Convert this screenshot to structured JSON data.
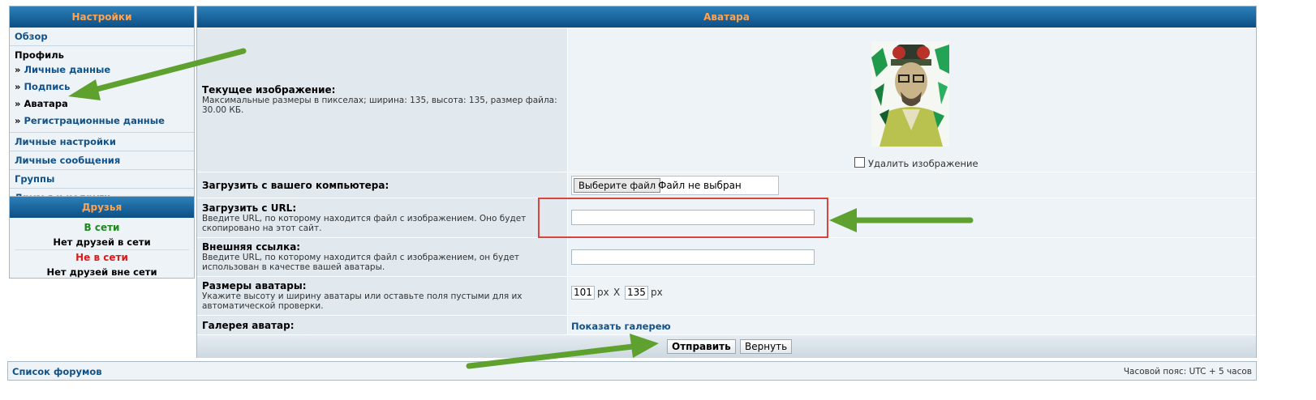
{
  "sidebar": {
    "title": "Настройки",
    "overview": "Обзор",
    "profile_title": "Профиль",
    "profile_items": [
      {
        "label": "Личные данные"
      },
      {
        "label": "Подпись"
      },
      {
        "label": "Аватара"
      },
      {
        "label": "Регистрационные данные"
      }
    ],
    "other_items": [
      {
        "label": "Личные настройки"
      },
      {
        "label": "Личные сообщения"
      },
      {
        "label": "Группы"
      },
      {
        "label": "Друзья и недруги"
      }
    ],
    "raquo": "»"
  },
  "friends": {
    "title": "Друзья",
    "online_label": "В сети",
    "online_empty": "Нет друзей в сети",
    "offline_label": "Не в сети",
    "offline_empty": "Нет друзей вне сети"
  },
  "avatar": {
    "title": "Аватара",
    "current_label": "Текущее изображение:",
    "current_explain": "Максимальные размеры в пикселах; ширина: 135, высота: 135, размер файла: 30.00 КБ.",
    "delete_label": "Удалить изображение",
    "upload_label": "Загрузить с вашего компьютера:",
    "file_button": "Выберите файл",
    "file_status": "Файл не выбран",
    "url_label": "Загрузить с URL:",
    "url_explain": "Введите URL, по которому находится файл с изображением. Оно будет скопировано на этот сайт.",
    "url_value": "",
    "link_label": "Внешняя ссылка:",
    "link_explain": "Введите URL, по которому находится файл с изображением, он будет использован в качестве вашей аватары.",
    "link_value": "",
    "dims_label": "Размеры аватары:",
    "dims_explain": "Укажите высоту и ширину аватары или оставьте поля пустыми для их автоматической проверки.",
    "width_value": "101",
    "height_value": "135",
    "px_unit": "px",
    "times": "X",
    "gallery_label": "Галерея аватар:",
    "gallery_link": "Показать галерею",
    "submit": "Отправить",
    "reset": "Вернуть"
  },
  "footer": {
    "forum_list": "Список форумов",
    "timezone": "Часовой пояс: UTC + 5 часов"
  },
  "colors": {
    "header_bg": "#1d6aa3",
    "header_text": "#ffa34f",
    "link": "#105289",
    "online": "#1c8a1c",
    "offline": "#e11919",
    "annotation_arrow": "#5ea12f",
    "highlight_box": "#d9453d"
  }
}
